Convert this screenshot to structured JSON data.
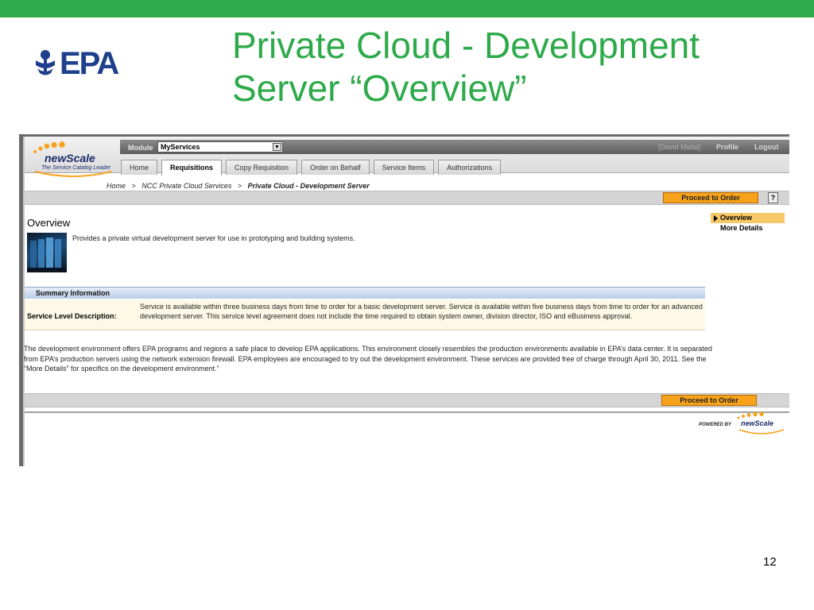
{
  "slide": {
    "title_line1": "Private Cloud - Development",
    "title_line2": "Server “Overview”",
    "page_number": "12",
    "logo_text": "EPA",
    "brand_color": "#2eaa4a"
  },
  "app": {
    "logo_word": "newScale",
    "logo_tagline": "The Service Catalog Leader",
    "module_label": "Module",
    "module_value": "MyServices",
    "user_name": "[David Matta]",
    "profile_label": "Profile",
    "logout_label": "Logout",
    "tabs": [
      {
        "label": "Home",
        "active": false
      },
      {
        "label": "Requisitions",
        "active": true
      },
      {
        "label": "Copy Requisition",
        "active": false
      },
      {
        "label": "Order on Behalf",
        "active": false
      },
      {
        "label": "Service Items",
        "active": false
      },
      {
        "label": "Authorizations",
        "active": false
      }
    ]
  },
  "breadcrumb": {
    "home": "Home",
    "sep": ">",
    "parent": "NCC Private Cloud Services",
    "current": "Private Cloud - Development Server"
  },
  "actions": {
    "proceed_label": "Proceed to Order",
    "help_label": "?",
    "accent_color": "#f7a21b"
  },
  "overview": {
    "title": "Overview",
    "description": "Provides a private virtual development server for use in prototyping and building systems."
  },
  "side_nav": [
    {
      "label": "Overview",
      "active": true
    },
    {
      "label": "More Details",
      "active": false
    }
  ],
  "summary": {
    "heading": "Summary Information",
    "label": "Service Level Description:",
    "value": "Service is available within three business days from time to order for a basic development server. Service is available within five business days from time to order for an advanced development server. This service level agreement does not include the time required to obtain system owner, division director, ISO and eBusiness approval."
  },
  "body_text": "The development environment offers EPA programs and regions a safe place to develop EPA applications. This environment closely resembles the production environments available in EPA’s data center. It is separated from EPA’s production servers using the network extension firewall. EPA employees are encouraged to try out the development environment. These services are provided free of charge through April 30, 2011. See the “More Details” for specifics on the development environment.”",
  "powered_by": {
    "prefix": "POWERED BY",
    "brand": "newScale"
  }
}
